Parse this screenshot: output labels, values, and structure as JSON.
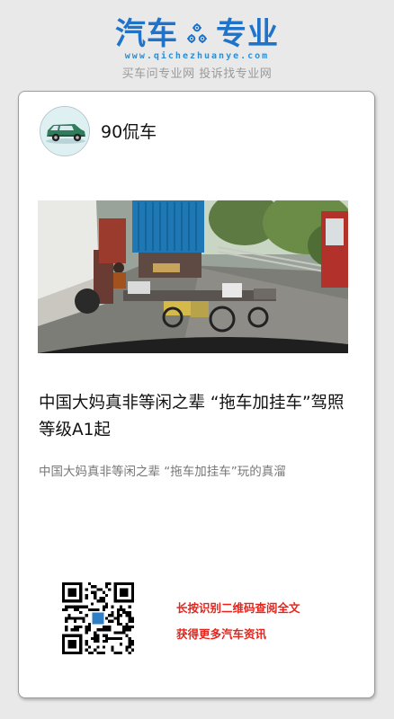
{
  "header": {
    "logo_left": "汽车",
    "logo_right": "专业",
    "logo_icon": "gears-icon",
    "url": "www.qichezhuanye.com",
    "slogan": "买车问专业网 投诉找专业网"
  },
  "article": {
    "author": "90侃车",
    "avatar_icon": "car-avatar",
    "photo": "street-photo-tricycle-trailer",
    "title": "中国大妈真非等闲之辈 “拖车加挂车”驾照等级A1起",
    "summary": "中国大妈真非等闲之辈 “拖车加挂车”玩的真溜"
  },
  "footer": {
    "qr_icon": "qr-code-icon",
    "cta_line1": "长按识别二维码查阅全文",
    "cta_line2": "获得更多汽车资讯"
  },
  "colors": {
    "brand_blue": "#1f74c9",
    "cta_red": "#e8231b",
    "background": "#e9e9e9"
  }
}
